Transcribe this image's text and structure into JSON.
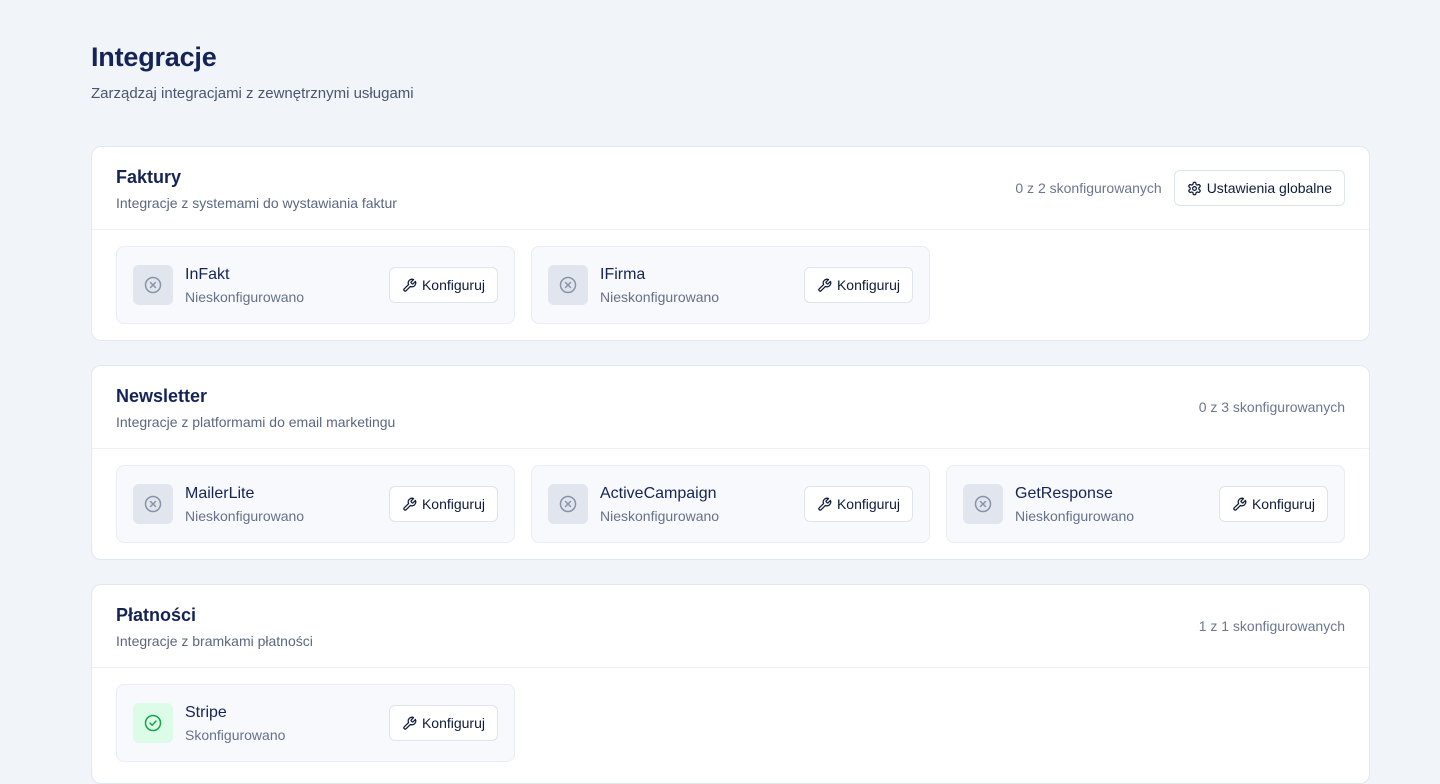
{
  "page": {
    "title": "Integracje",
    "subtitle": "Zarządzaj integracjami z zewnętrznymi usługami"
  },
  "sections": [
    {
      "title": "Faktury",
      "description": "Integracje z systemami do wystawiania faktur",
      "count": "0 z 2 skonfigurowanych",
      "global_settings_label": "Ustawienia globalne",
      "items": [
        {
          "name": "InFakt",
          "status": "Nieskonfigurowano",
          "configure_label": "Konfiguruj",
          "status_icon": "x-circle-icon"
        },
        {
          "name": "IFirma",
          "status": "Nieskonfigurowano",
          "configure_label": "Konfiguruj",
          "status_icon": "x-circle-icon"
        }
      ]
    },
    {
      "title": "Newsletter",
      "description": "Integracje z platformami do email marketingu",
      "count": "0 z 3 skonfigurowanych",
      "items": [
        {
          "name": "MailerLite",
          "status": "Nieskonfigurowano",
          "configure_label": "Konfiguruj",
          "status_icon": "x-circle-icon"
        },
        {
          "name": "ActiveCampaign",
          "status": "Nieskonfigurowano",
          "configure_label": "Konfiguruj",
          "status_icon": "x-circle-icon"
        },
        {
          "name": "GetResponse",
          "status": "Nieskonfigurowano",
          "configure_label": "Konfiguruj",
          "status_icon": "x-circle-icon"
        }
      ]
    },
    {
      "title": "Płatności",
      "description": "Integracje z bramkami płatności",
      "count": "1 z 1 skonfigurowanych",
      "items": [
        {
          "name": "Stripe",
          "status": "Skonfigurowano",
          "configure_label": "Konfiguruj",
          "status_icon": "check-circle-icon"
        }
      ]
    }
  ],
  "colors": {
    "background": "#f1f4f9",
    "heading": "#142456",
    "configured": "#16a34a",
    "configured_bg": "#dcfce7",
    "unconfigured": "#8a94a8"
  }
}
